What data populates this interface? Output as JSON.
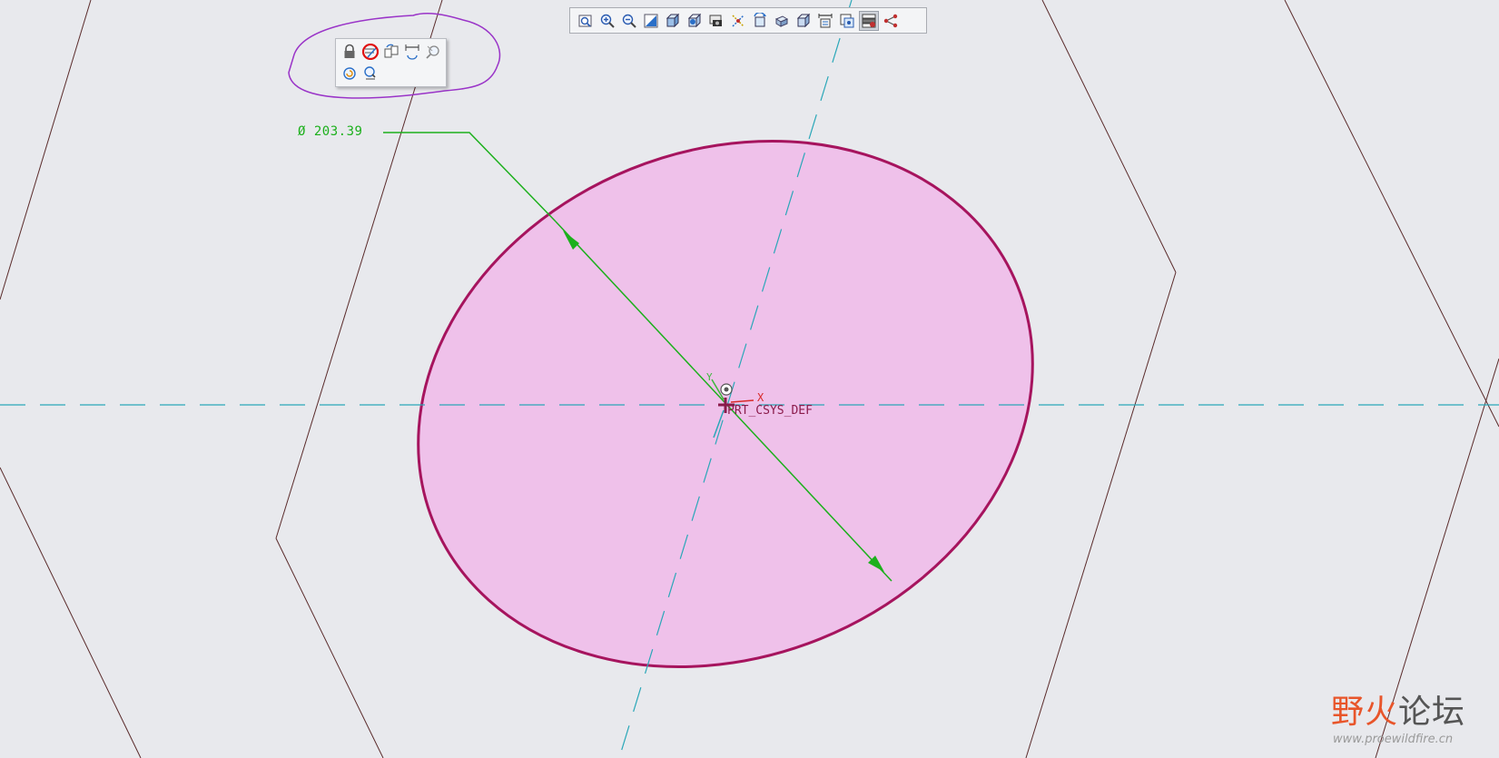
{
  "viewport": {
    "background": "#e8e9ed",
    "feature_fill": "#efc1ea",
    "feature_edge": "#a6145e",
    "dimension_color": "#1cb01c",
    "datum_axis_color": "#2aa7b8"
  },
  "view_toolbar": {
    "buttons": [
      {
        "icon": "refit-icon"
      },
      {
        "icon": "zoom-in-icon"
      },
      {
        "icon": "zoom-out-icon"
      },
      {
        "icon": "repaint-icon"
      },
      {
        "icon": "display-style-icon"
      },
      {
        "icon": "saved-orientations-icon"
      },
      {
        "icon": "view-manager-icon"
      },
      {
        "icon": "datum-display-filters-icon"
      },
      {
        "icon": "spin-center-icon"
      },
      {
        "icon": "sketch-view-icon"
      },
      {
        "icon": "named-views-icon"
      },
      {
        "icon": "dimension-display-icon"
      },
      {
        "icon": "constraint-display-icon"
      },
      {
        "icon": "grid-display-icon",
        "active": true
      },
      {
        "icon": "vertex-display-icon"
      }
    ]
  },
  "mini_toolbar": {
    "row1": [
      {
        "icon": "lock-icon"
      },
      {
        "icon": "modify-dimension-icon",
        "highlighted": true
      },
      {
        "icon": "replace-reference-icon"
      },
      {
        "icon": "dimension-icon"
      },
      {
        "icon": "zoom-selection-icon"
      }
    ],
    "row2": [
      {
        "icon": "regenerate-icon"
      },
      {
        "icon": "search-reference-icon"
      }
    ],
    "annotation_color": "#9a34c8",
    "highlight_color": "#e01010"
  },
  "dimension": {
    "text": "Ø 203.39"
  },
  "csys": {
    "name": "PRT_CSYS_DEF",
    "x_label": "X",
    "y_label": "Y"
  },
  "watermark": {
    "title_part1": "野火",
    "title_part2": "论坛",
    "url": "www.proewildfire.cn"
  }
}
